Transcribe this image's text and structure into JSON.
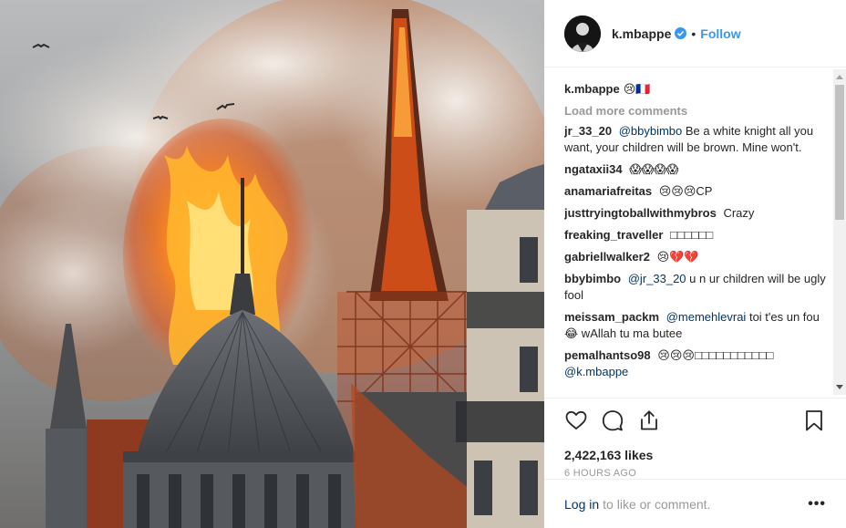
{
  "header": {
    "username": "k.mbappe",
    "separator": "•",
    "follow_label": "Follow"
  },
  "caption": {
    "username": "k.mbappe",
    "text": "😢🇫🇷"
  },
  "load_more": "Load more comments",
  "comments": [
    {
      "user": "jr_33_20",
      "mention": "@bbybimbo",
      "text": "Be a white knight all you want, your children will be brown. Mine won't."
    },
    {
      "user": "ngataxii34",
      "mention": "",
      "text": "😱😱😱😱"
    },
    {
      "user": "anamariafreitas",
      "mention": "",
      "text": "😢😢😢CP"
    },
    {
      "user": "justtryingtoballwithmybros",
      "mention": "",
      "text": "Crazy"
    },
    {
      "user": "freaking_traveller",
      "mention": "",
      "text": "□□□□□□"
    },
    {
      "user": "gabriellwalker2",
      "mention": "",
      "text": "😢💔💔"
    },
    {
      "user": "bbybimbo",
      "mention": "@jr_33_20",
      "text": "u n ur children will be ugly fool"
    },
    {
      "user": "meissam_packm",
      "mention": "@memehlevrai",
      "text": "toi t'es un fou 😂 wAllah tu ma butee"
    },
    {
      "user": "pemalhantso98",
      "mention": "",
      "text": "😢😢😢□□□□□□□□□□□",
      "mention_after": "@k.mbappe"
    }
  ],
  "likes": "2,422,163 likes",
  "timestamp": "6 HOURS AGO",
  "footer": {
    "login_label": "Log in",
    "login_rest": "to like or comment.",
    "more_label": "•••"
  },
  "icons": {
    "like": "heart-icon",
    "comment": "comment-bubble-icon",
    "share": "share-icon",
    "save": "bookmark-icon",
    "verified": "verified-badge-icon"
  },
  "colors": {
    "accent": "#3897f0",
    "link": "#003569",
    "muted": "#999999"
  }
}
